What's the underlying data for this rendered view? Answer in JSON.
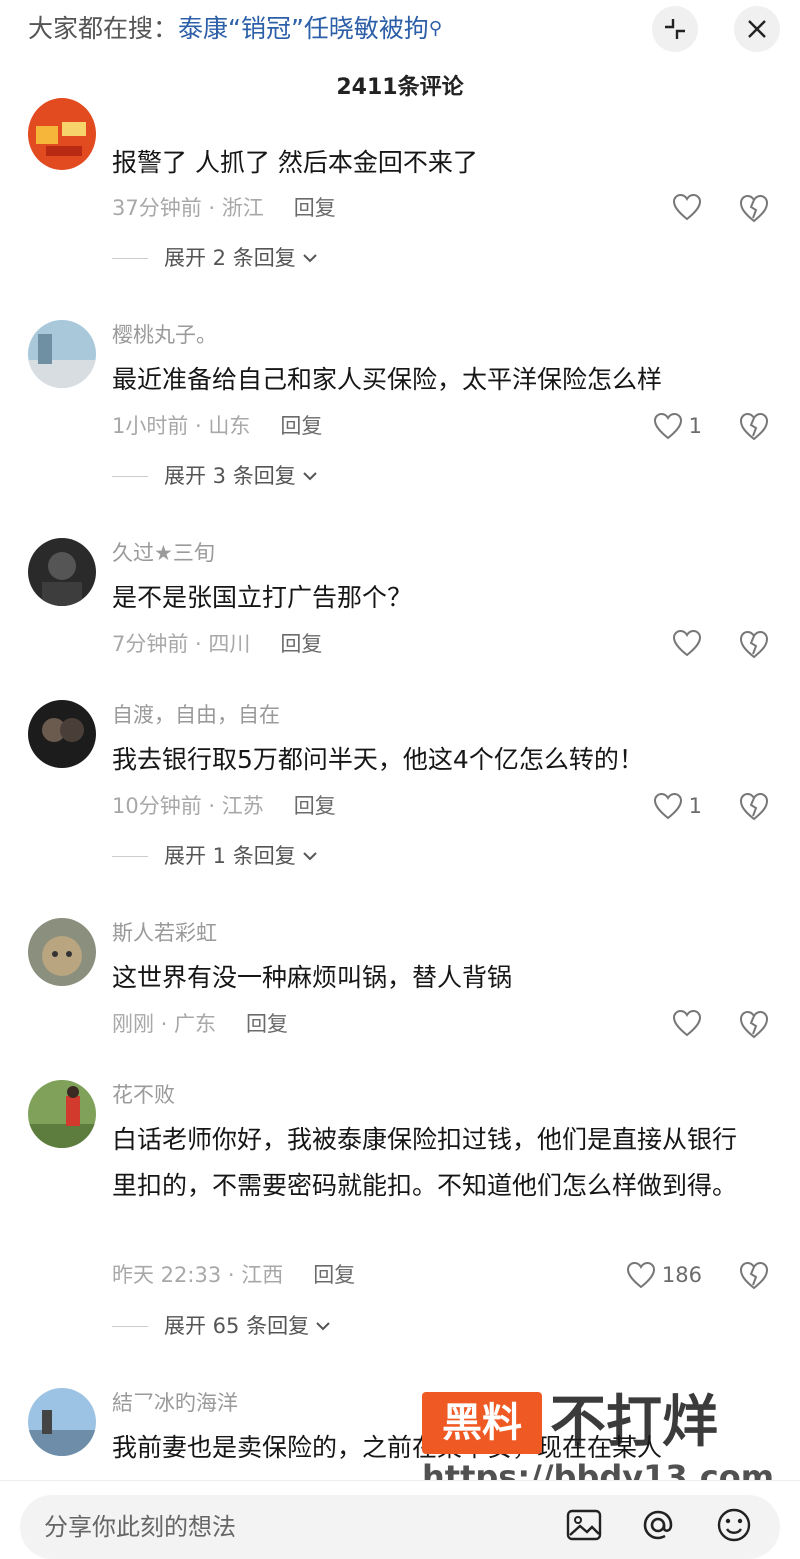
{
  "header": {
    "search_prefix": "大家都在搜：",
    "search_term": "泰康“销冠”任晓敏被拘",
    "comments_count": "2411条评论"
  },
  "comments": [
    {
      "username": "",
      "text": "报警了 人抓了 然后本金回不来了",
      "time_location": "37分钟前 · 浙江",
      "reply_label": "回复",
      "likes": "",
      "expand_label": "展开 2 条回复"
    },
    {
      "username": "樱桃丸子。",
      "text": "最近准备给自己和家人买保险，太平洋保险怎么样",
      "time_location": "1小时前 · 山东",
      "reply_label": "回复",
      "likes": "1",
      "expand_label": "展开 3 条回复"
    },
    {
      "username": "久过★三旬",
      "text": "是不是张国立打广告那个？",
      "time_location": "7分钟前 · 四川",
      "reply_label": "回复",
      "likes": "",
      "expand_label": ""
    },
    {
      "username": "自渡，自由，自在",
      "text": "我去银行取5万都问半天，他这4个亿怎么转的！",
      "time_location": "10分钟前 · 江苏",
      "reply_label": "回复",
      "likes": "1",
      "expand_label": "展开 1 条回复"
    },
    {
      "username": "斯人若彩虹",
      "text": "这世界有没一种麻烦叫锅，替人背锅",
      "time_location": "刚刚 · 广东",
      "reply_label": "回复",
      "likes": "",
      "expand_label": ""
    },
    {
      "username": "花不败",
      "text": "白话老师你好，我被泰康保险扣过钱，他们是直接从银行里扣的，不需要密码就能扣。不知道他们怎么样做到得。",
      "time_location": "昨天 22:33 · 江西",
      "reply_label": "回复",
      "likes": "186",
      "expand_label": "展开 65 条回复"
    },
    {
      "username": "結乛冰旳海洋",
      "text": "我前妻也是卖保险的，之前在某平安，现在在某人",
      "time_location": "",
      "reply_label": "",
      "likes": "",
      "expand_label": ""
    }
  ],
  "watermark": {
    "badge": "黑料",
    "tagline": "不打烊",
    "url": "https://bbdy13.com"
  },
  "bottom": {
    "input_placeholder": "分享你此刻的想法"
  },
  "icons": [
    "search-icon",
    "collapse-icon",
    "close-icon",
    "heart-icon",
    "dislike-icon",
    "chevron-down-icon",
    "image-icon",
    "at-icon",
    "emoji-icon"
  ]
}
